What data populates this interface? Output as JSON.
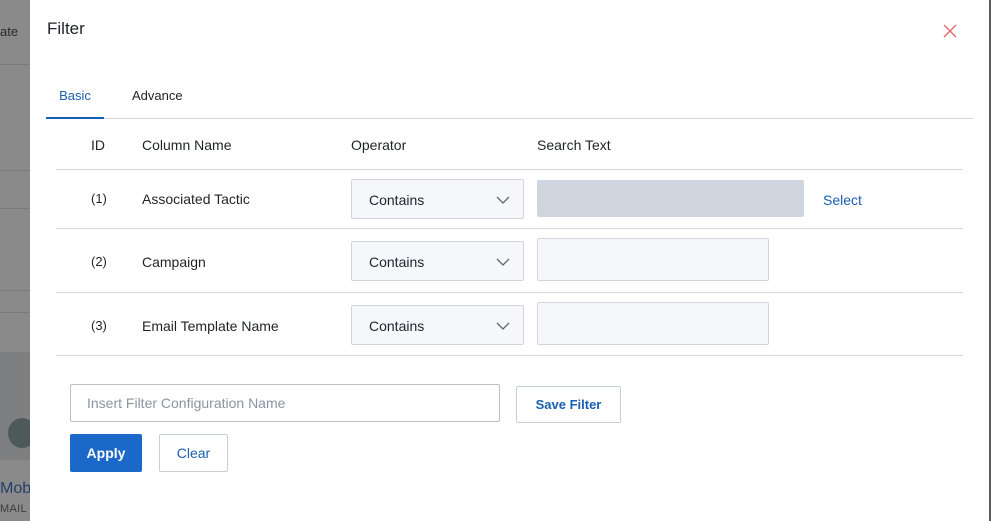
{
  "background": {
    "title_fragment": "ate",
    "card_title_fragment": "Mob",
    "card_subtitle_fragment": "MAIL"
  },
  "filter": {
    "title": "Filter",
    "close_icon": "close-icon",
    "tabs": [
      {
        "label": "Basic",
        "active": true
      },
      {
        "label": "Advance",
        "active": false
      }
    ],
    "table": {
      "headers": {
        "id": "ID",
        "column_name": "Column Name",
        "operator": "Operator",
        "search_text": "Search Text"
      },
      "rows": [
        {
          "id": "(1)",
          "column": "Associated Tactic",
          "operator": "Contains",
          "search_value": "",
          "search_disabled": true,
          "action": "Select"
        },
        {
          "id": "(2)",
          "column": "Campaign",
          "operator": "Contains",
          "search_value": "",
          "search_disabled": false
        },
        {
          "id": "(3)",
          "column": "Email Template Name",
          "operator": "Contains",
          "search_value": "",
          "search_disabled": false
        }
      ]
    },
    "config_name": {
      "placeholder": "Insert Filter Configuration Name",
      "value": ""
    },
    "save_filter_label": "Save Filter",
    "apply_label": "Apply",
    "clear_label": "Clear"
  },
  "colors": {
    "accent": "#1a68c8",
    "link": "#1a5fb4",
    "disabled_field": "#cfd6df",
    "close_icon": "#e06767"
  }
}
